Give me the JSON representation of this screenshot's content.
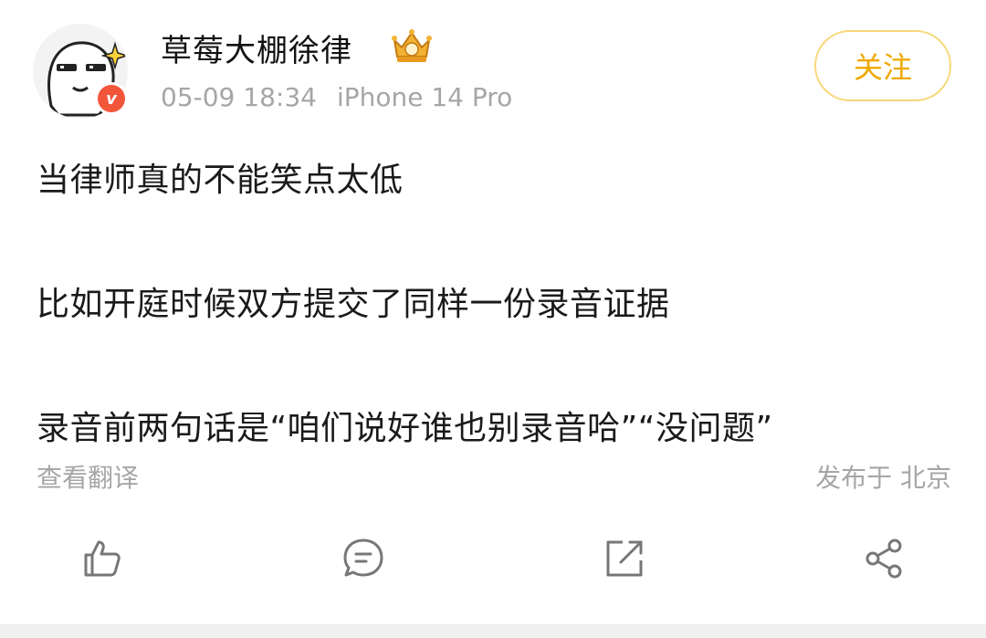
{
  "post": {
    "author": {
      "name": "草莓大棚徐律",
      "verified_icon": "verified-v-badge-icon",
      "rank_icon": "crown-badge-icon"
    },
    "time": "05-09 18:34",
    "device": "iPhone 14 Pro",
    "follow_label": "关注",
    "paragraphs": [
      "当律师真的不能笑点太低",
      "比如开庭时候双方提交了同样一份录音证据",
      "录音前两句话是“咱们说好谁也别录音哈”“没问题”"
    ],
    "translate_label": "查看翻译",
    "location": "发布于 北京"
  },
  "actions": {
    "like_icon": "thumbs-up-icon",
    "comment_icon": "comment-icon",
    "repost_icon": "repost-icon",
    "share_icon": "share-icon"
  },
  "colors": {
    "accent": "#f0a800",
    "follow_border": "#f7d87a",
    "meta_text": "#a6a6a6",
    "body_text": "#1a1a1a",
    "verified": "#f2563a"
  }
}
